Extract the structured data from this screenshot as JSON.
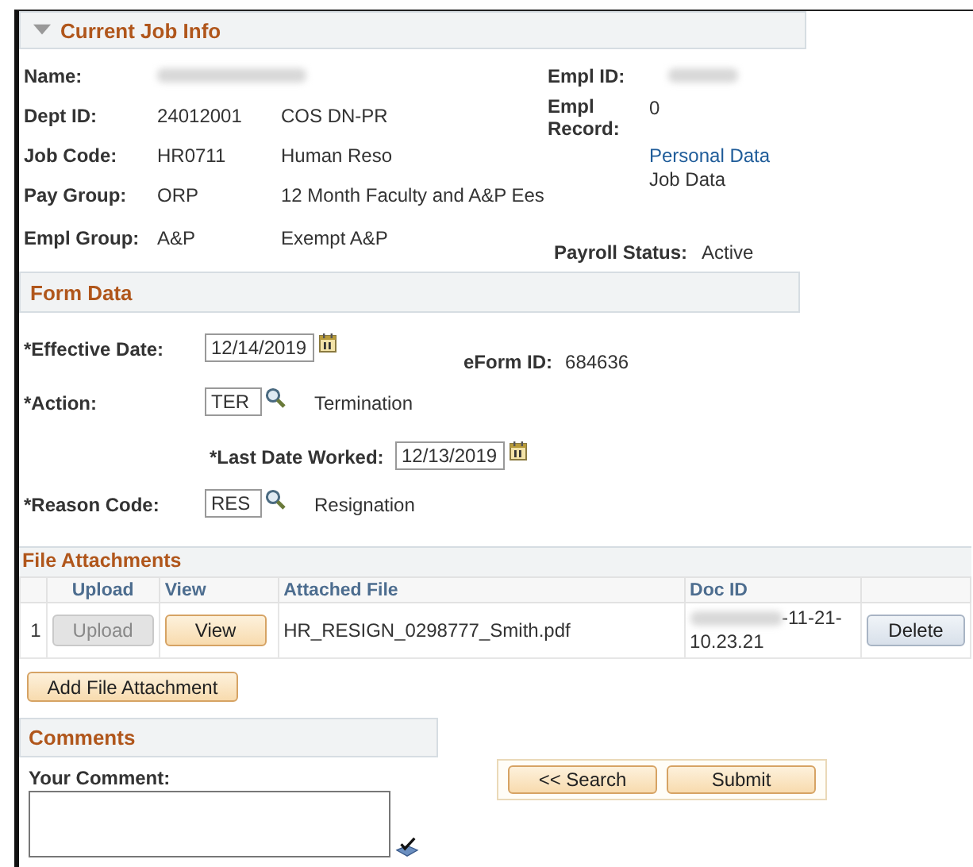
{
  "current_job_info": {
    "title": "Current Job Info",
    "expanded": true,
    "left": [
      {
        "label": "Name:",
        "redacted": true
      },
      {
        "label": "Dept ID:",
        "code": "24012001",
        "description": "COS DN-PR"
      },
      {
        "label": "Job Code:",
        "code": "HR0711",
        "description": "Human Reso"
      },
      {
        "label": "Pay Group:",
        "code": "ORP",
        "description": "12 Month Faculty and A&P Ees"
      },
      {
        "label": "Empl Group:",
        "code": "A&P",
        "description": "Exempt A&P"
      }
    ],
    "empl_id": {
      "label": "Empl ID:",
      "redacted": true
    },
    "empl_record": {
      "label": "Empl Record:",
      "value": "0"
    },
    "links": [
      {
        "text": "Personal Data",
        "kind": "link"
      },
      {
        "text": "Job Data",
        "kind": "text"
      }
    ],
    "payroll_status": {
      "label": "Payroll Status:",
      "value": "Active"
    }
  },
  "form_data": {
    "title": "Form Data",
    "fields": [
      {
        "kind": "date",
        "label": "*Effective Date:",
        "value": "12/14/2019",
        "indented": false
      },
      {
        "kind": "prompt",
        "label": "*Action:",
        "value": "TER",
        "description": "Termination",
        "indented": false
      },
      {
        "kind": "date",
        "label": "*Last Date Worked:",
        "value": "12/13/2019",
        "indented": true
      },
      {
        "kind": "prompt",
        "label": "*Reason Code:",
        "value": "RES",
        "description": "Resignation",
        "indented": false
      }
    ],
    "eform_id": {
      "label": "eForm ID:",
      "value": "684636"
    }
  },
  "file_attachments": {
    "title": "File Attachments",
    "columns": [
      "Upload",
      "View",
      "Attached File",
      "Doc ID"
    ],
    "rows": [
      {
        "index": "1",
        "upload": {
          "label": "Upload",
          "disabled": true
        },
        "view": "View",
        "file": "HR_RESIGN_0298777_Smith.pdf",
        "doc_id_redacted": true,
        "doc_id": [
          "-11-21-",
          "10.23.21"
        ],
        "delete": "Delete"
      }
    ],
    "add_button": "Add File Attachment"
  },
  "comments": {
    "title": "Comments",
    "label": "Your Comment:"
  },
  "buttons": [
    "<< Search",
    "Submit"
  ]
}
